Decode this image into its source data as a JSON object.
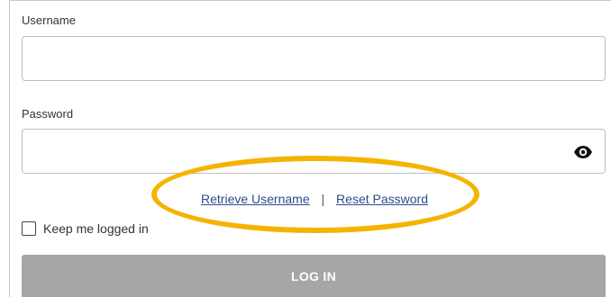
{
  "form": {
    "username": {
      "label": "Username",
      "value": "",
      "placeholder": ""
    },
    "password": {
      "label": "Password",
      "value": "",
      "placeholder": ""
    },
    "password_toggle_icon": "eye-icon",
    "links": {
      "retrieve_username": "Retrieve Username",
      "separator": "|",
      "reset_password": "Reset Password"
    },
    "keep_logged_in": {
      "label": "Keep me logged in",
      "checked": false
    },
    "login_button": "LOG IN"
  },
  "annotation": {
    "color": "#f4b400"
  },
  "colors": {
    "link": "#2f4a8c",
    "button_disabled": "#a6a6a6"
  }
}
